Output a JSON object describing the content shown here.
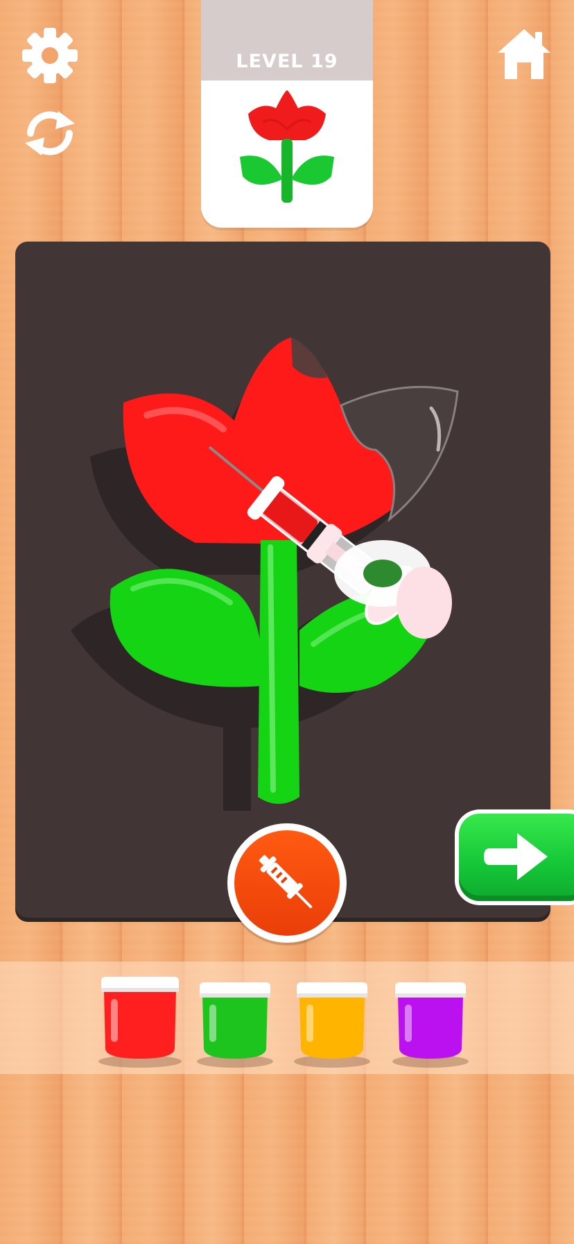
{
  "level": {
    "label": "LEVEL 19"
  },
  "icons": {
    "settings": "gear-icon",
    "restart": "refresh-icon",
    "home": "home-icon",
    "next": "arrow-right-icon",
    "tool": "syringe-icon"
  },
  "palette": [
    {
      "name": "red",
      "color": "#ff1f1f"
    },
    {
      "name": "green",
      "color": "#1ec41e"
    },
    {
      "name": "yellow",
      "color": "#ffb400"
    },
    {
      "name": "purple",
      "color": "#bb10f0"
    }
  ],
  "colors": {
    "board": "#413535",
    "flower_red": "#ff1a1a",
    "stem_green": "#14d414",
    "next_button": "#14c637",
    "tool_button": "#ea3e08"
  }
}
